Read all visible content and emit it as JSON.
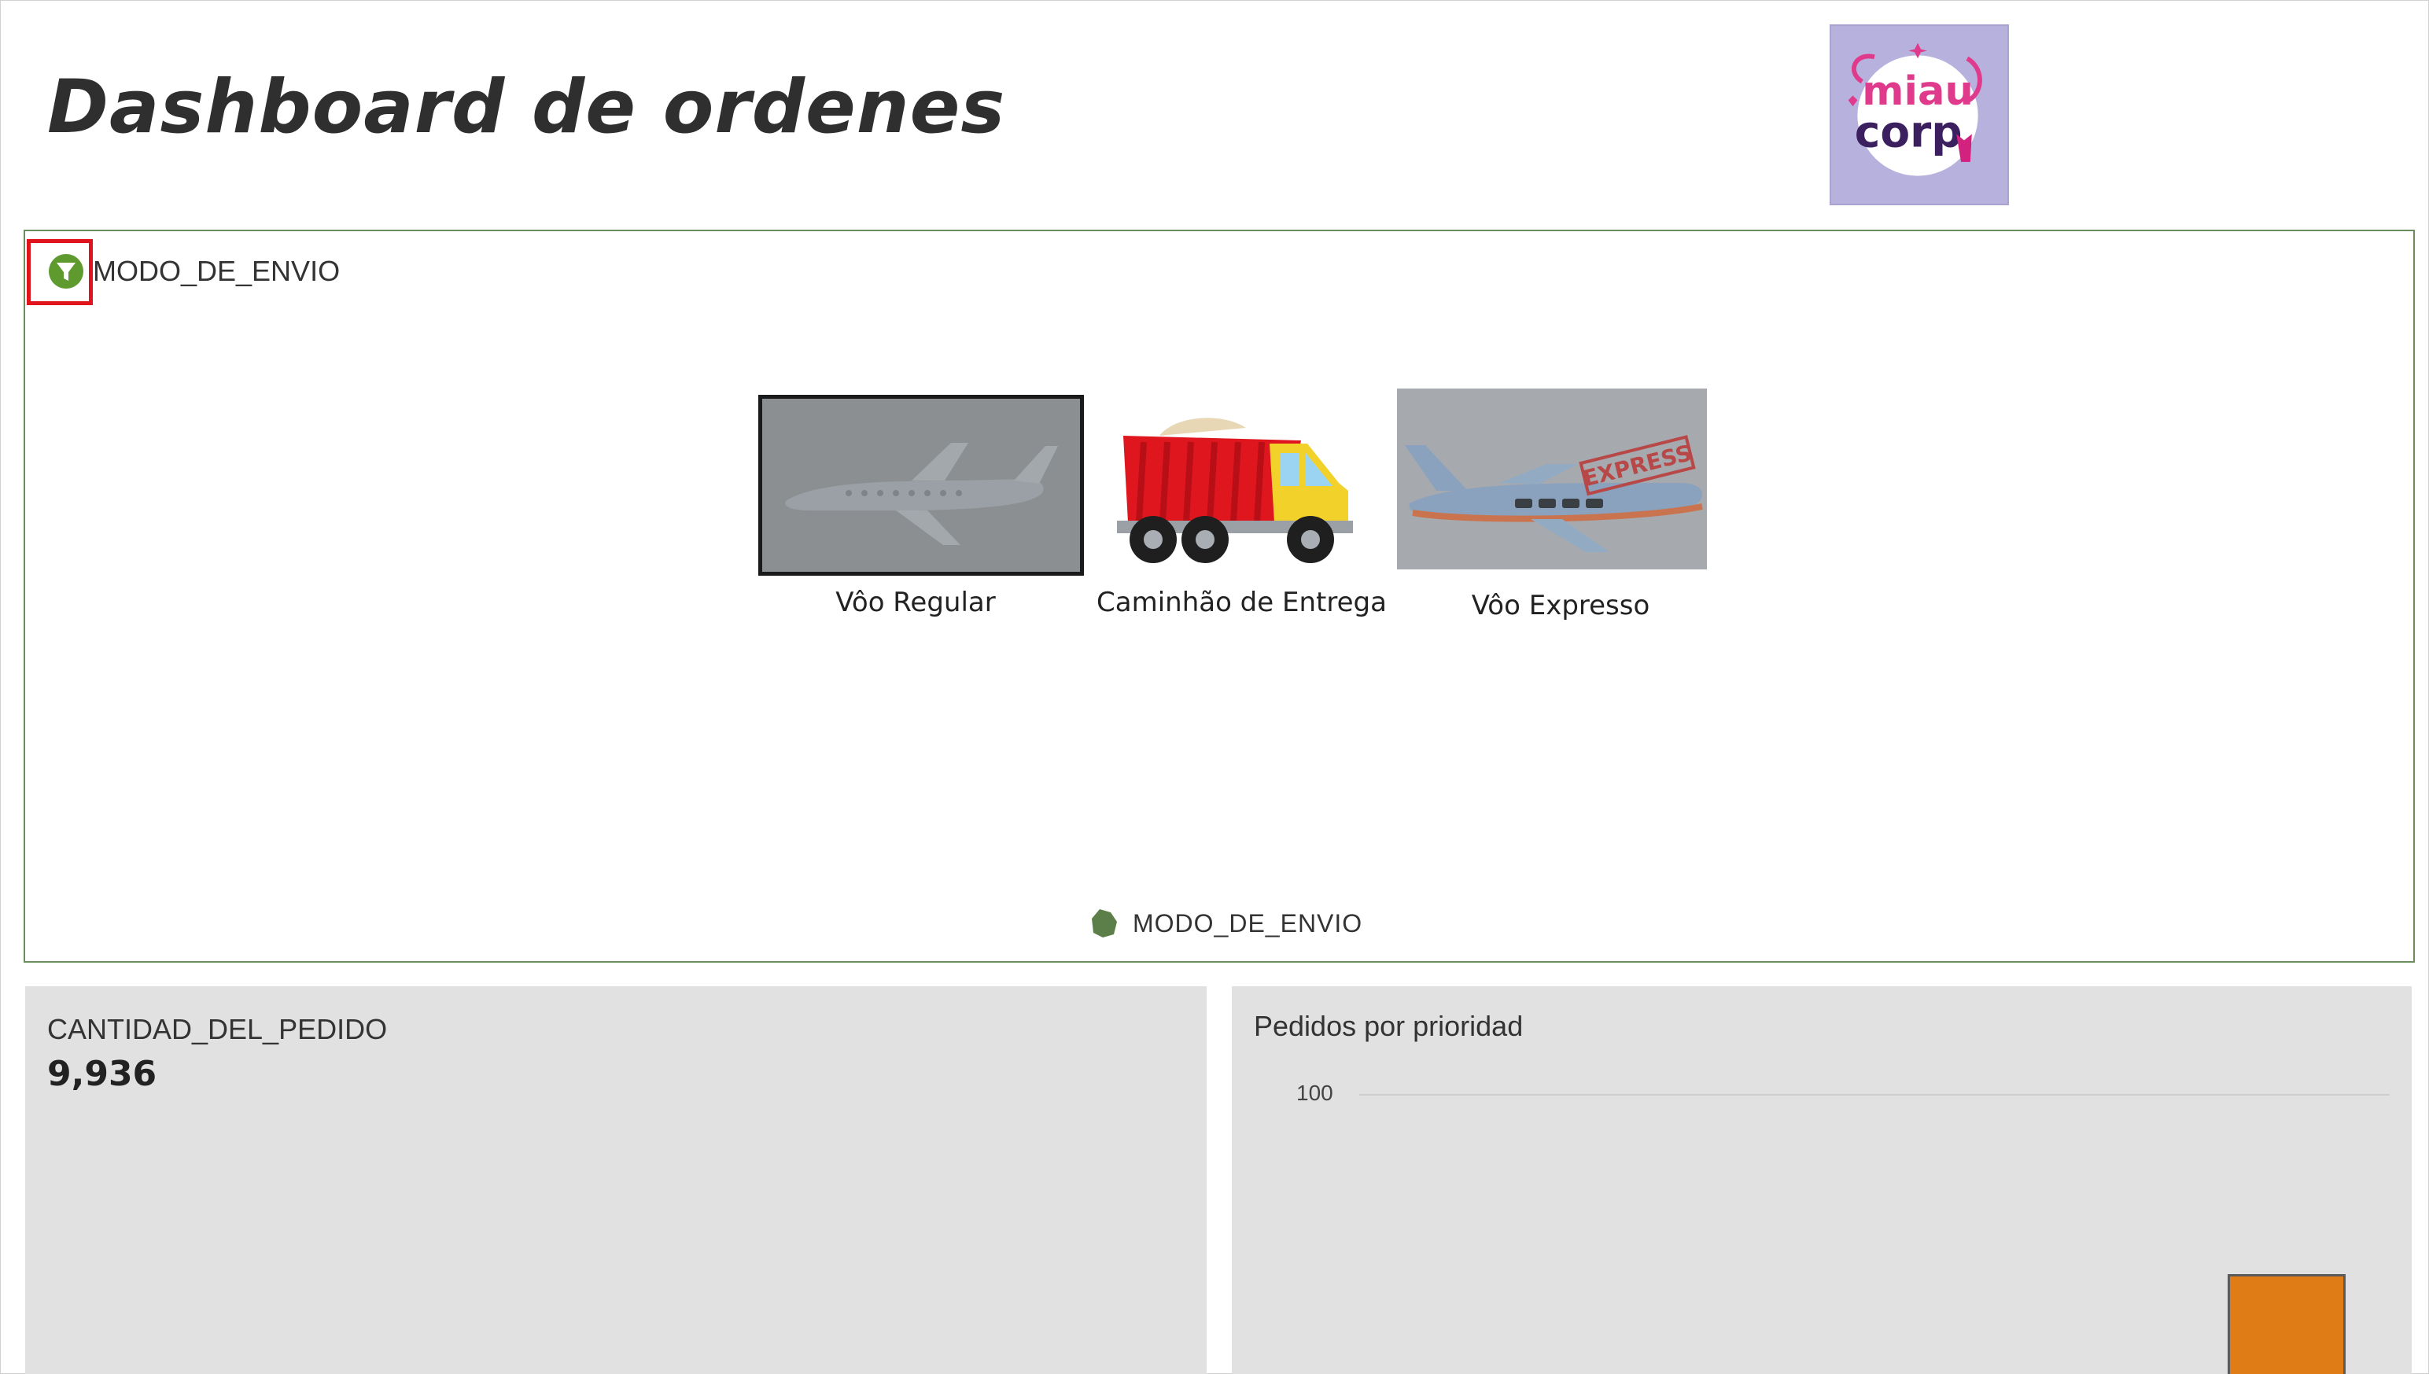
{
  "title": "Dashboard de ordenes",
  "logo": {
    "line1": "miau",
    "line2": "corp"
  },
  "filter": {
    "label": "MODO_DE_ENVIO",
    "options": [
      {
        "label": "Vôo Regular",
        "selected": true
      },
      {
        "label": "Caminhão de Entrega",
        "selected": false
      },
      {
        "label": "Vôo Expresso",
        "selected": false,
        "stamp": "EXPRESS"
      }
    ],
    "legend_label": "MODO_DE_ENVIO"
  },
  "kpi": {
    "title": "CANTIDAD_DEL_PEDIDO",
    "value": "9,936"
  },
  "chart_data": {
    "type": "bar",
    "title": "Pedidos por prioridad",
    "y_ticks": [
      "100"
    ],
    "values": [
      44
    ],
    "colors": [
      "#e07c15"
    ]
  },
  "colors": {
    "accent_green": "#6a8f5d",
    "highlight_red": "#e0141d",
    "bar_orange": "#e07c15",
    "tile_gray": "#e1e1e1"
  }
}
